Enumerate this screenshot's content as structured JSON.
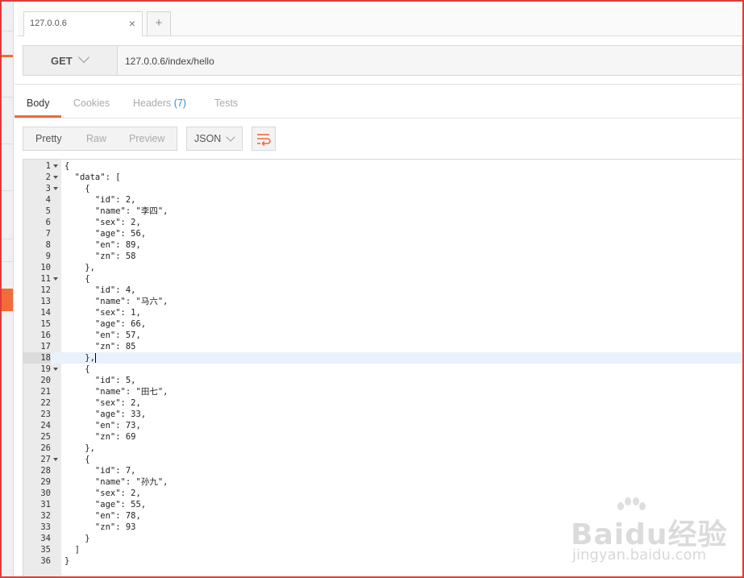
{
  "tab": {
    "title": "127.0.0.6",
    "close": "×",
    "add": "+"
  },
  "request": {
    "method": "GET",
    "url": "127.0.0.6/index/hello"
  },
  "response_tabs": {
    "body": "Body",
    "cookies": "Cookies",
    "headers": "Headers",
    "headers_count": "(7)",
    "tests": "Tests"
  },
  "format": {
    "pretty": "Pretty",
    "raw": "Raw",
    "preview": "Preview",
    "language": "JSON"
  },
  "editor": {
    "highlight_line": 18,
    "lines": [
      {
        "n": "1",
        "t": "{",
        "f": true
      },
      {
        "n": "2",
        "t": "  \"data\": [",
        "f": true
      },
      {
        "n": "3",
        "t": "    {",
        "f": true
      },
      {
        "n": "4",
        "t": "      \"id\": 2,"
      },
      {
        "n": "5",
        "t": "      \"name\": \"李四\","
      },
      {
        "n": "6",
        "t": "      \"sex\": 2,"
      },
      {
        "n": "7",
        "t": "      \"age\": 56,"
      },
      {
        "n": "8",
        "t": "      \"en\": 89,"
      },
      {
        "n": "9",
        "t": "      \"zn\": 58"
      },
      {
        "n": "10",
        "t": "    },"
      },
      {
        "n": "11",
        "t": "    {",
        "f": true
      },
      {
        "n": "12",
        "t": "      \"id\": 4,"
      },
      {
        "n": "13",
        "t": "      \"name\": \"马六\","
      },
      {
        "n": "14",
        "t": "      \"sex\": 1,"
      },
      {
        "n": "15",
        "t": "      \"age\": 66,"
      },
      {
        "n": "16",
        "t": "      \"en\": 57,"
      },
      {
        "n": "17",
        "t": "      \"zn\": 85"
      },
      {
        "n": "18",
        "t": "    },"
      },
      {
        "n": "19",
        "t": "    {",
        "f": true
      },
      {
        "n": "20",
        "t": "      \"id\": 5,"
      },
      {
        "n": "21",
        "t": "      \"name\": \"田七\","
      },
      {
        "n": "22",
        "t": "      \"sex\": 2,"
      },
      {
        "n": "23",
        "t": "      \"age\": 33,"
      },
      {
        "n": "24",
        "t": "      \"en\": 73,"
      },
      {
        "n": "25",
        "t": "      \"zn\": 69"
      },
      {
        "n": "26",
        "t": "    },"
      },
      {
        "n": "27",
        "t": "    {",
        "f": true
      },
      {
        "n": "28",
        "t": "      \"id\": 7,"
      },
      {
        "n": "29",
        "t": "      \"name\": \"孙九\","
      },
      {
        "n": "30",
        "t": "      \"sex\": 2,"
      },
      {
        "n": "31",
        "t": "      \"age\": 55,"
      },
      {
        "n": "32",
        "t": "      \"en\": 78,"
      },
      {
        "n": "33",
        "t": "      \"zn\": 93"
      },
      {
        "n": "34",
        "t": "    }"
      },
      {
        "n": "35",
        "t": "  ]"
      },
      {
        "n": "36",
        "t": "}"
      }
    ]
  },
  "watermark": {
    "brand": "Baidu经验",
    "site": "jingyan.baidu.com"
  },
  "colors": {
    "accent": "#f26b3a",
    "link": "#2f8ed1",
    "frame": "#e03a3a"
  }
}
